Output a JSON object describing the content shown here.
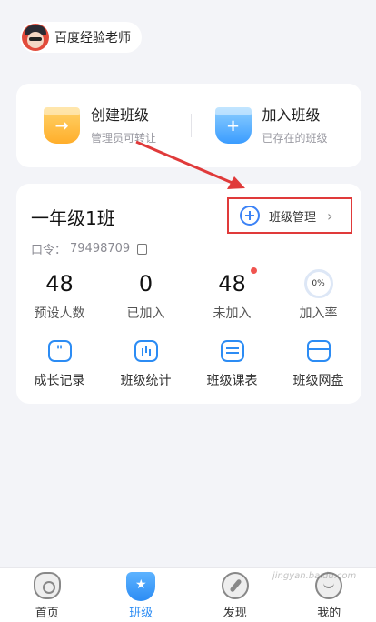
{
  "user": {
    "name": "百度经验老师"
  },
  "actions": [
    {
      "title": "创建班级",
      "subtitle": "管理员可转让",
      "icon": "create-class-icon",
      "color": "#ffae2b"
    },
    {
      "title": "加入班级",
      "subtitle": "已存在的班级",
      "icon": "join-class-icon",
      "color": "#3a9cff"
    }
  ],
  "class_card": {
    "name": "一年级1班",
    "manage_label": "班级管理",
    "code_label": "口令：",
    "code_value": "79498709",
    "stats": [
      {
        "value": "48",
        "label": "预设人数"
      },
      {
        "value": "0",
        "label": "已加入"
      },
      {
        "value": "48",
        "label": "未加入"
      },
      {
        "value": "0%",
        "label": "加入率"
      }
    ],
    "tools": [
      {
        "label": "成长记录",
        "icon": "growth-record-icon"
      },
      {
        "label": "班级统计",
        "icon": "class-stats-icon"
      },
      {
        "label": "班级课表",
        "icon": "class-schedule-icon"
      },
      {
        "label": "班级网盘",
        "icon": "class-drive-icon"
      }
    ]
  },
  "tabs": [
    {
      "label": "首页",
      "icon": "home-icon"
    },
    {
      "label": "班级",
      "icon": "class-icon",
      "active": true
    },
    {
      "label": "发现",
      "icon": "discover-icon"
    },
    {
      "label": "我的",
      "icon": "profile-icon"
    }
  ],
  "colors": {
    "accent": "#2c8cf4",
    "highlight": "#e03a3a"
  },
  "watermark": "jingyan.baidu.com"
}
